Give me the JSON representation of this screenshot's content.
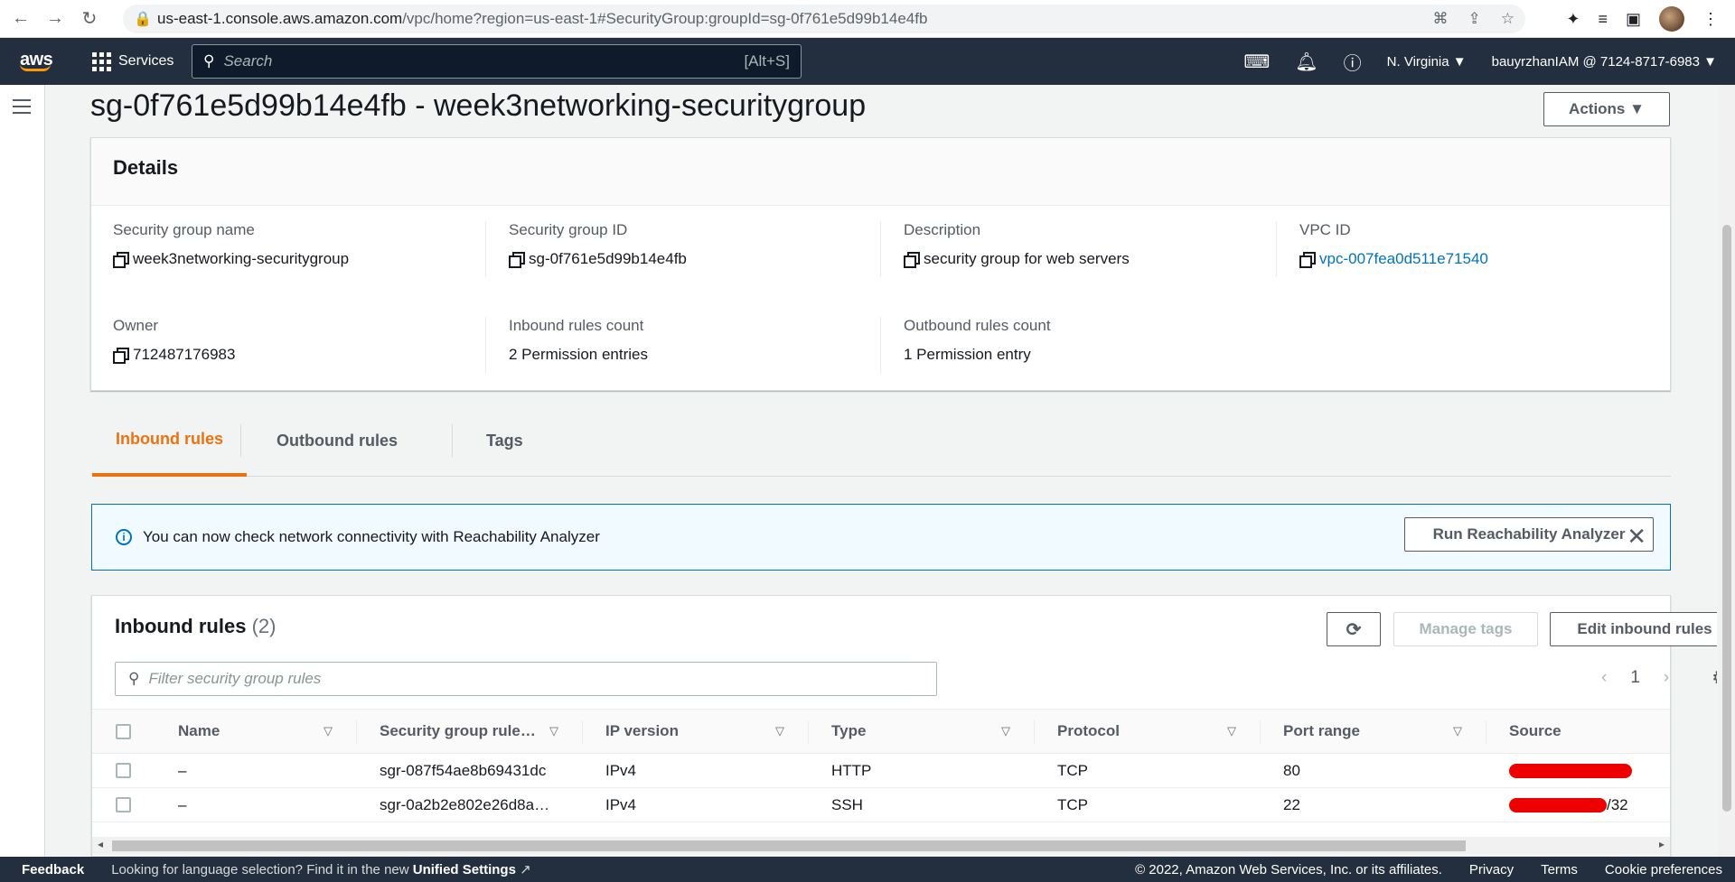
{
  "browser": {
    "url_host": "us-east-1.console.aws.amazon.com",
    "url_path": "/vpc/home?region=us-east-1#SecurityGroup:groupId=sg-0f761e5d99b14e4fb"
  },
  "aws": {
    "logo": "aws",
    "services_label": "Services",
    "search_placeholder": "Search",
    "search_hint": "[Alt+S]",
    "region": "N. Virginia ▼",
    "account": "bauyrzhanIAM @ 7124-8717-6983 ▼"
  },
  "page": {
    "title": "sg-0f761e5d99b14e4fb - week3networking-securitygroup",
    "actions_label": "Actions ▼"
  },
  "details": {
    "heading": "Details",
    "fields": [
      {
        "key": "Security group name",
        "value": "week3networking-securitygroup"
      },
      {
        "key": "Security group ID",
        "value": "sg-0f761e5d99b14e4fb"
      },
      {
        "key": "Description",
        "value": "security group for web servers"
      },
      {
        "key": "VPC ID",
        "value": "vpc-007fea0d511e71540"
      },
      {
        "key": "Owner",
        "value": "712487176983"
      },
      {
        "key": "Inbound rules count",
        "value": "2 Permission entries"
      },
      {
        "key": "Outbound rules count",
        "value": "1 Permission entry"
      }
    ]
  },
  "tabs": [
    "Inbound rules",
    "Outbound rules",
    "Tags"
  ],
  "alert": {
    "message": "You can now check network connectivity with Reachability Analyzer",
    "button": "Run Reachability Analyzer"
  },
  "inbound": {
    "title": "Inbound rules",
    "count": "(2)",
    "manage_tags": "Manage tags",
    "edit_rules": "Edit inbound rules",
    "filter_placeholder": "Filter security group rules",
    "page": "1",
    "columns": [
      "Name",
      "Security group rule…",
      "IP version",
      "Type",
      "Protocol",
      "Port range",
      "Source"
    ],
    "rows": [
      {
        "name": "–",
        "rule_id": "sgr-087f54ae8b69431dc",
        "ip": "IPv4",
        "type": "HTTP",
        "protocol": "TCP",
        "port": "80",
        "source_suffix": ""
      },
      {
        "name": "–",
        "rule_id": "sgr-0a2b2e802e26d8a…",
        "ip": "IPv4",
        "type": "SSH",
        "protocol": "TCP",
        "port": "22",
        "source_suffix": "/32"
      }
    ]
  },
  "footer": {
    "feedback": "Feedback",
    "lang_text": "Looking for language selection? Find it in the new",
    "lang_link": "Unified Settings",
    "copyright": "© 2022, Amazon Web Services, Inc. or its affiliates.",
    "privacy": "Privacy",
    "terms": "Terms",
    "cookies": "Cookie preferences"
  }
}
